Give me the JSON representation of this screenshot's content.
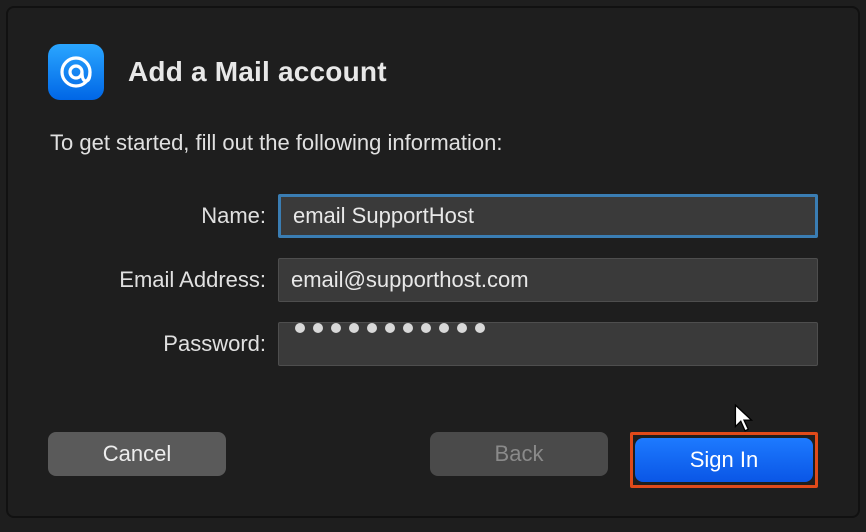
{
  "header": {
    "title": "Add a Mail account"
  },
  "instruction": "To get started, fill out the following information:",
  "form": {
    "labels": {
      "name": "Name:",
      "email": "Email Address:",
      "password": "Password:"
    },
    "values": {
      "name": "email SupportHost",
      "email": "email@supporthost.com",
      "password_dot_count": 11
    }
  },
  "buttons": {
    "cancel": "Cancel",
    "back": "Back",
    "signin": "Sign In"
  }
}
